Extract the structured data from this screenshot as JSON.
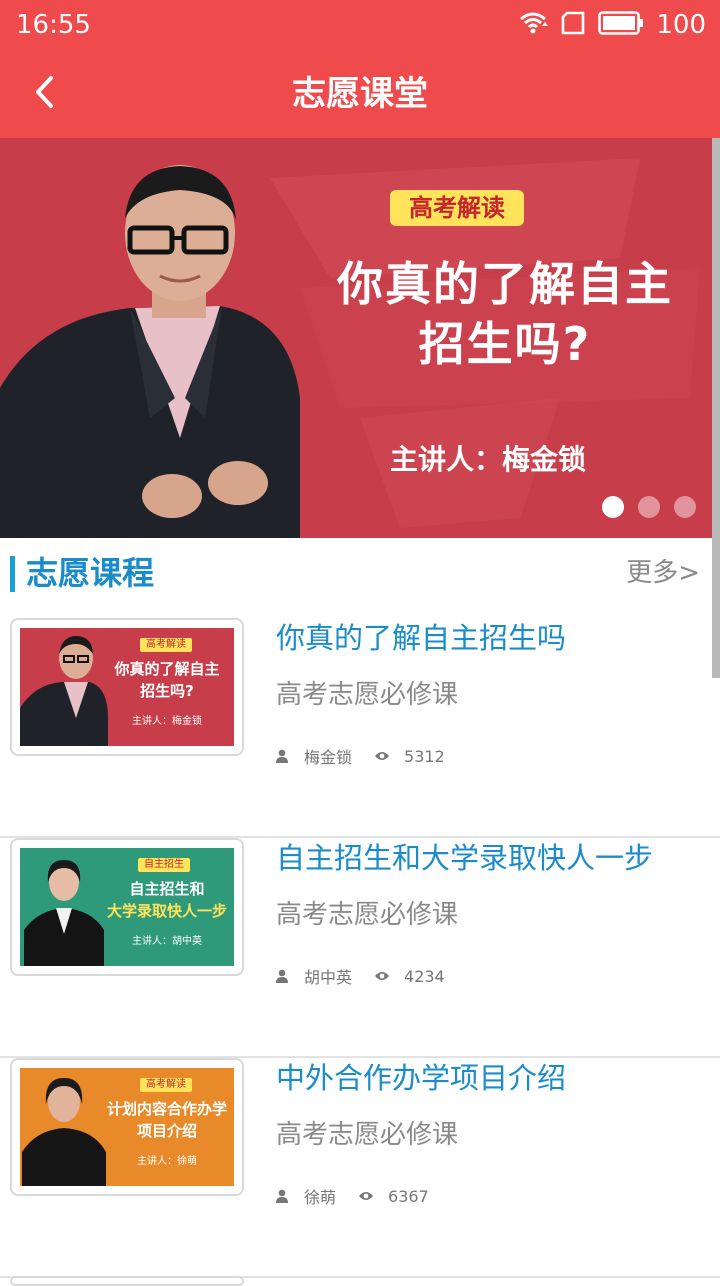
{
  "status": {
    "time": "16:55",
    "battery": "100"
  },
  "appbar": {
    "title": "志愿课堂"
  },
  "banner": {
    "tag": "高考解读",
    "title_line1": "你真的了解自主",
    "title_line2": "招生吗?",
    "speaker": "主讲人：梅金锁",
    "dots_total": 3,
    "dot_active": 1
  },
  "section": {
    "title": "志愿课程",
    "more": "更多>"
  },
  "courses": [
    {
      "title": "你真的了解自主招生吗",
      "subtitle": "高考志愿必修课",
      "author": "梅金锁",
      "views": "5312",
      "thumb": {
        "tag": "高考解读",
        "line1": "你真的了解自主",
        "line2": "招生吗?",
        "speaker": "主讲人：梅金锁"
      }
    },
    {
      "title": "自主招生和大学录取快人一步",
      "subtitle": "高考志愿必修课",
      "author": "胡中英",
      "views": "4234",
      "thumb": {
        "tag": "自主招生",
        "line1": "自主招生和",
        "line2": "大学录取快人一步",
        "speaker": "主讲人：胡中英"
      }
    },
    {
      "title": "中外合作办学项目介绍",
      "subtitle": "高考志愿必修课",
      "author": "徐萌",
      "views": "6367",
      "thumb": {
        "tag": "高考解读",
        "line1": "计划内容合作办学",
        "line2": "项目介绍",
        "speaker": "主讲人：徐萌"
      }
    }
  ],
  "colors": {
    "brand_red": "#ef4a4c",
    "link_blue": "#1a8ccc",
    "accent_bar": "#1aa0d8",
    "gray_text": "#8a8a8a"
  },
  "icons": {
    "back": "chevron-left-icon",
    "wifi": "wifi-icon",
    "sim": "sim-card-icon",
    "battery": "battery-icon",
    "author": "person-icon",
    "views": "eye-icon"
  }
}
